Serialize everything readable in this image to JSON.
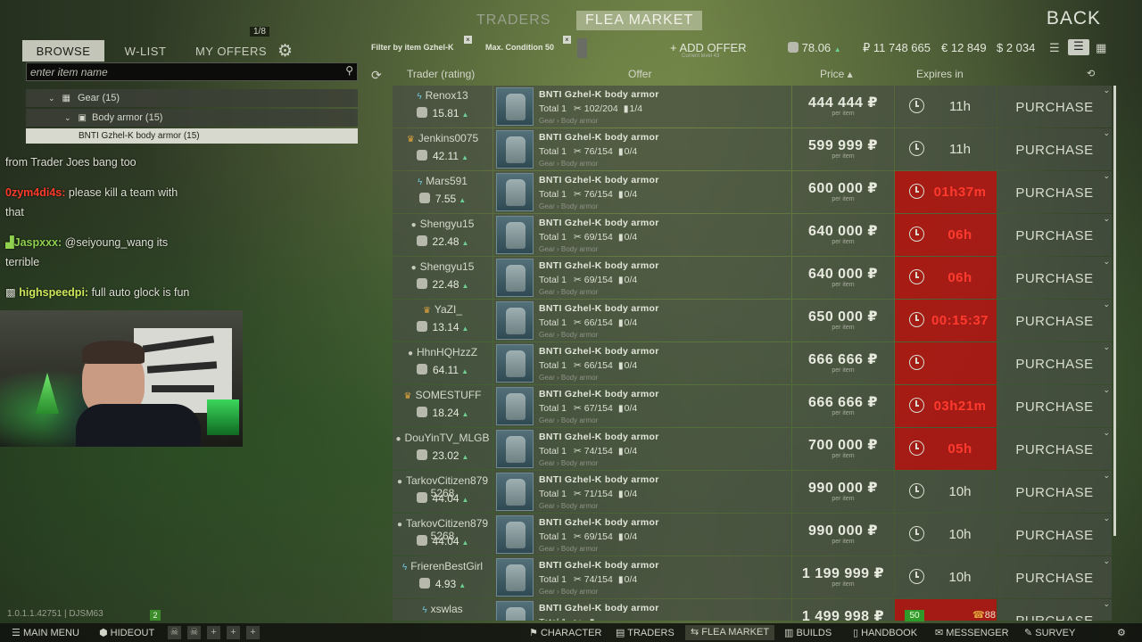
{
  "top_nav": {
    "traders": "TRADERS",
    "flea_market": "FLEA MARKET",
    "back": "BACK"
  },
  "left_tabs": {
    "browse": "BROWSE",
    "wishlist": "W-LIST",
    "my_offers": "MY OFFERS",
    "offers_count": "1/8"
  },
  "search": {
    "placeholder": "enter item name"
  },
  "tree": [
    {
      "label": "Gear (15)"
    },
    {
      "label": "Body armor (15)"
    },
    {
      "label": "BNTI Gzhel-K body armor (15)"
    }
  ],
  "chat": [
    {
      "user": "",
      "text": "from Trader Joes bang too",
      "color": "#dde0d4"
    },
    {
      "user": "0zym4di4s:",
      "text": "please kill a team with that",
      "color": "#ff3a2a"
    },
    {
      "user": "Jaspxxx:",
      "text": "@seiyoung_wang its terrible",
      "color": "#8fd14f"
    },
    {
      "user": "highspeedpi:",
      "text": "full auto glock is fun",
      "color": "#cde85a"
    }
  ],
  "version": {
    "text": "1.0.1.1.42751 | DJSM63",
    "badge": "2"
  },
  "filters": {
    "item": "Filter by item Gzhel-K",
    "condition": "Max. Condition 50"
  },
  "add_offer": {
    "label": "+ ADD OFFER",
    "sub": "Current level 43"
  },
  "balances": {
    "rating": "78.06",
    "roubles": "₽ 11 748 665",
    "euros": "€ 12 849",
    "dollars": "$ 2 034"
  },
  "table_header": {
    "trader": "Trader (rating)",
    "offer": "Offer",
    "price": "Price ▴",
    "expires": "Expires in"
  },
  "offers": [
    {
      "icon": "lightning",
      "trader": "Renox13",
      "rating": "15.81",
      "name": "BNTI Gzhel-K body armor",
      "total": "Total 1",
      "durability": "102/204",
      "mags": "1/4",
      "path": "Gear › Body armor",
      "price": "444 444 ₽",
      "unit": "per item",
      "expires": "11h",
      "expired_red": false,
      "action": "PURCHASE"
    },
    {
      "icon": "crown",
      "trader": "Jenkins0075",
      "rating": "42.11",
      "name": "BNTI Gzhel-K body armor",
      "total": "Total 1",
      "durability": "76/154",
      "mags": "0/4",
      "path": "Gear › Body armor",
      "price": "599 999 ₽",
      "unit": "per item",
      "expires": "11h",
      "expired_red": false,
      "action": "PURCHASE"
    },
    {
      "icon": "lightning",
      "trader": "Mars591",
      "rating": "7.55",
      "name": "BNTI Gzhel-K body armor",
      "total": "Total 1",
      "durability": "76/154",
      "mags": "0/4",
      "path": "Gear › Body armor",
      "price": "600 000 ₽",
      "unit": "per item",
      "expires": "01h37m",
      "expired_red": true,
      "action": "PURCHASE"
    },
    {
      "icon": "person",
      "trader": "Shengyu15",
      "rating": "22.48",
      "name": "BNTI Gzhel-K body armor",
      "total": "Total 1",
      "durability": "69/154",
      "mags": "0/4",
      "path": "Gear › Body armor",
      "price": "640 000 ₽",
      "unit": "per item",
      "expires": "06h",
      "expired_red": true,
      "action": "PURCHASE"
    },
    {
      "icon": "person",
      "trader": "Shengyu15",
      "rating": "22.48",
      "name": "BNTI Gzhel-K body armor",
      "total": "Total 1",
      "durability": "69/154",
      "mags": "0/4",
      "path": "Gear › Body armor",
      "price": "640 000 ₽",
      "unit": "per item",
      "expires": "06h",
      "expired_red": true,
      "action": "PURCHASE"
    },
    {
      "icon": "crown",
      "trader": "YaZI_",
      "rating": "13.14",
      "name": "BNTI Gzhel-K body armor",
      "total": "Total 1",
      "durability": "66/154",
      "mags": "0/4",
      "path": "Gear › Body armor",
      "price": "650 000 ₽",
      "unit": "per item",
      "expires": "00:15:37",
      "expired_red": true,
      "action": "PURCHASE"
    },
    {
      "icon": "person",
      "trader": "HhnHQHzzZ",
      "rating": "64.11",
      "name": "BNTI Gzhel-K body armor",
      "total": "Total 1",
      "durability": "66/154",
      "mags": "0/4",
      "path": "Gear › Body armor",
      "price": "666 666 ₽",
      "unit": "per item",
      "expires": "",
      "expired_red": true,
      "action": "PURCHASE"
    },
    {
      "icon": "crown",
      "trader": "SOMESTUFF",
      "rating": "18.24",
      "name": "BNTI Gzhel-K body armor",
      "total": "Total 1",
      "durability": "67/154",
      "mags": "0/4",
      "path": "Gear › Body armor",
      "price": "666 666 ₽",
      "unit": "per item",
      "expires": "03h21m",
      "expired_red": true,
      "action": "PURCHASE"
    },
    {
      "icon": "person",
      "trader": "DouYinTV_MLGB",
      "rating": "23.02",
      "name": "BNTI Gzhel-K body armor",
      "total": "Total 1",
      "durability": "74/154",
      "mags": "0/4",
      "path": "Gear › Body armor",
      "price": "700 000 ₽",
      "unit": "per item",
      "expires": "05h",
      "expired_red": true,
      "action": "PURCHASE"
    },
    {
      "icon": "person",
      "trader": "TarkovCitizen879 5268",
      "rating": "44.04",
      "name": "BNTI Gzhel-K body armor",
      "total": "Total 1",
      "durability": "71/154",
      "mags": "0/4",
      "path": "Gear › Body armor",
      "price": "990 000 ₽",
      "unit": "per item",
      "expires": "10h",
      "expired_red": false,
      "action": "PURCHASE"
    },
    {
      "icon": "person",
      "trader": "TarkovCitizen879 5268",
      "rating": "44.04",
      "name": "BNTI Gzhel-K body armor",
      "total": "Total 1",
      "durability": "69/154",
      "mags": "0/4",
      "path": "Gear › Body armor",
      "price": "990 000 ₽",
      "unit": "per item",
      "expires": "10h",
      "expired_red": false,
      "action": "PURCHASE"
    },
    {
      "icon": "lightning",
      "trader": "FrierenBestGirl",
      "rating": "4.93",
      "name": "BNTI Gzhel-K body armor",
      "total": "Total 1",
      "durability": "74/154",
      "mags": "0/4",
      "path": "Gear › Body armor",
      "price": "1 199 999 ₽",
      "unit": "per item",
      "expires": "10h",
      "expired_red": false,
      "action": "PURCHASE"
    },
    {
      "icon": "lightning",
      "trader": "xswlas",
      "rating": "",
      "name": "BNTI Gzhel-K body armor",
      "total": "Total 1",
      "durability": "",
      "mags": "",
      "path": "",
      "price": "1 499 998 ₽",
      "unit": "",
      "expires": "",
      "expired_red": true,
      "action": "PURCHASE"
    }
  ],
  "bottom_bar": {
    "main_menu": "MAIN MENU",
    "hideout": "HIDEOUT",
    "character": "CHARACTER",
    "traders": "TRADERS",
    "flea_market": "FLEA MARKET",
    "builds": "BUILDS",
    "handbook": "HANDBOOK",
    "messenger": "MESSENGER",
    "survey": "SURVEY"
  },
  "overlay": {
    "level_badge": "50",
    "counter": "88"
  },
  "colors": {
    "expired_red": "#af1412",
    "timer_red": "#ff3a2e",
    "selected_row": "#d7d9cf",
    "rating_up": "#6dcf95"
  }
}
